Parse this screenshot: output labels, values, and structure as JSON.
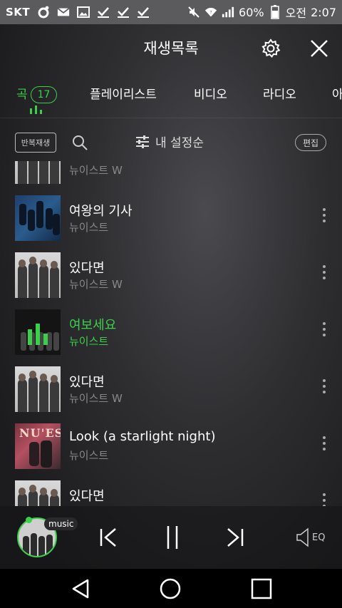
{
  "status_bar": {
    "carrier": "SKT",
    "battery": "60%",
    "ampm": "오전",
    "time": "2:07"
  },
  "header": {
    "title": "재생목록"
  },
  "tabs": [
    {
      "label": "곡",
      "count": "17"
    },
    {
      "label": "플레이리스트"
    },
    {
      "label": "비디오"
    },
    {
      "label": "라디오"
    },
    {
      "label": "아"
    }
  ],
  "toolbar": {
    "repeat_label": "반복재생",
    "sort_label": "내 설정순",
    "edit_label": "편집"
  },
  "tracks": [
    {
      "title": "",
      "artist": "뉴이스트 W",
      "cover": "bw"
    },
    {
      "title": "여왕의 기사",
      "artist": "뉴이스트",
      "cover": "blue"
    },
    {
      "title": "있다면",
      "artist": "뉴이스트 W",
      "cover": "bw"
    },
    {
      "title": "여보세요",
      "artist": "뉴이스트",
      "cover": "dark",
      "playing": true
    },
    {
      "title": "있다면",
      "artist": "뉴이스트 W",
      "cover": "bw"
    },
    {
      "title": "Look (a starlight night)",
      "artist": "뉴이스트",
      "cover": "red",
      "cover_text": "NU'EST"
    },
    {
      "title": "있다면",
      "artist": "",
      "cover": "bw"
    }
  ],
  "player": {
    "source_badge": "music",
    "eq_label": "EQ"
  },
  "colors": {
    "accent": "#3ad04b",
    "background": "#1b1b1d",
    "status_bar": "#5b5b5d"
  },
  "icons": {
    "status_left": [
      "circle-icon",
      "mail-icon",
      "image-icon",
      "check-download-icon",
      "check-download-icon",
      "check-download-icon"
    ],
    "status_right": [
      "mute-icon",
      "wifi-icon",
      "signal-icon",
      "battery-icon"
    ],
    "header": [
      "gear-icon",
      "close-icon"
    ],
    "player": [
      "previous-icon",
      "pause-icon",
      "next-icon",
      "eq-icon"
    ],
    "nav": [
      "back-icon",
      "home-icon",
      "recents-icon"
    ]
  }
}
